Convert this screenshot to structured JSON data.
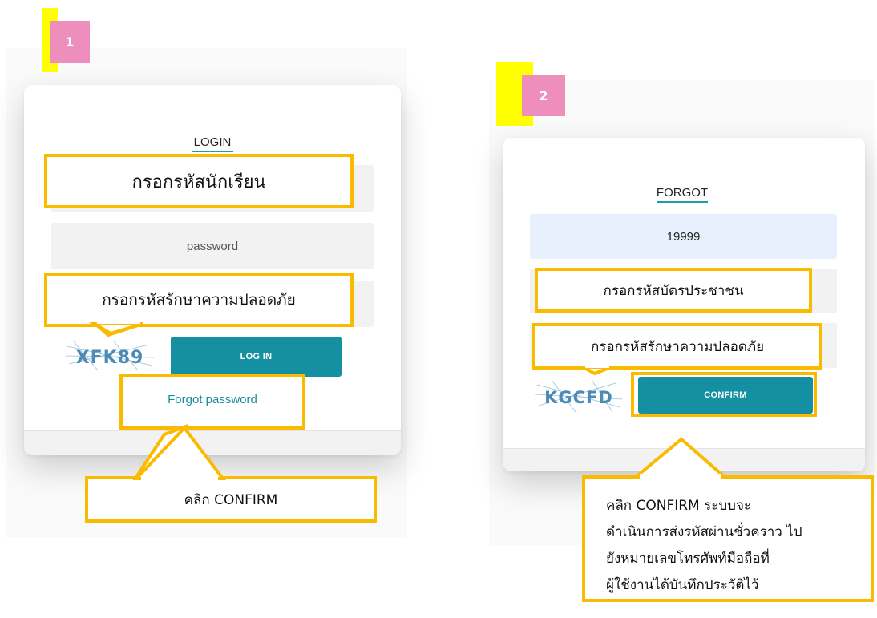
{
  "step1": {
    "badge": "1",
    "title": "LOGIN",
    "student_id_hint": "กรอกรหัสนักเรียน",
    "password_placeholder": "password",
    "security_hint": "กรอกรหัสรักษาความปลอดภัย",
    "captcha_text": "XFK89",
    "login_button": "LOG IN",
    "forgot_link": "Forgot password",
    "click_note": "คลิก CONFIRM"
  },
  "step2": {
    "badge": "2",
    "title": "FORGOT",
    "username_value": "19999",
    "id_card_hint": "กรอกรหัสบัตรประชาชน",
    "security_hint": "กรอกรหัสรักษาความปลอดภัย",
    "captcha_text": "KGCFD",
    "confirm_button": "CONFIRM",
    "note_lines": [
      "คลิก CONFIRM ระบบจะ",
      "ดำเนินการส่งรหัสผ่านชั่วคราว ไป",
      "ยังหมายเลขโทรศัพท์มือถือที่",
      "ผู้ใช้งานได้บันทึกประวัติไว้"
    ]
  },
  "colors": {
    "callout_border": "#f9ba00",
    "button": "#1590a2",
    "badge": "#ee8ebc",
    "yellow_marker": "#ffff00",
    "link": "#1a8c9e"
  }
}
